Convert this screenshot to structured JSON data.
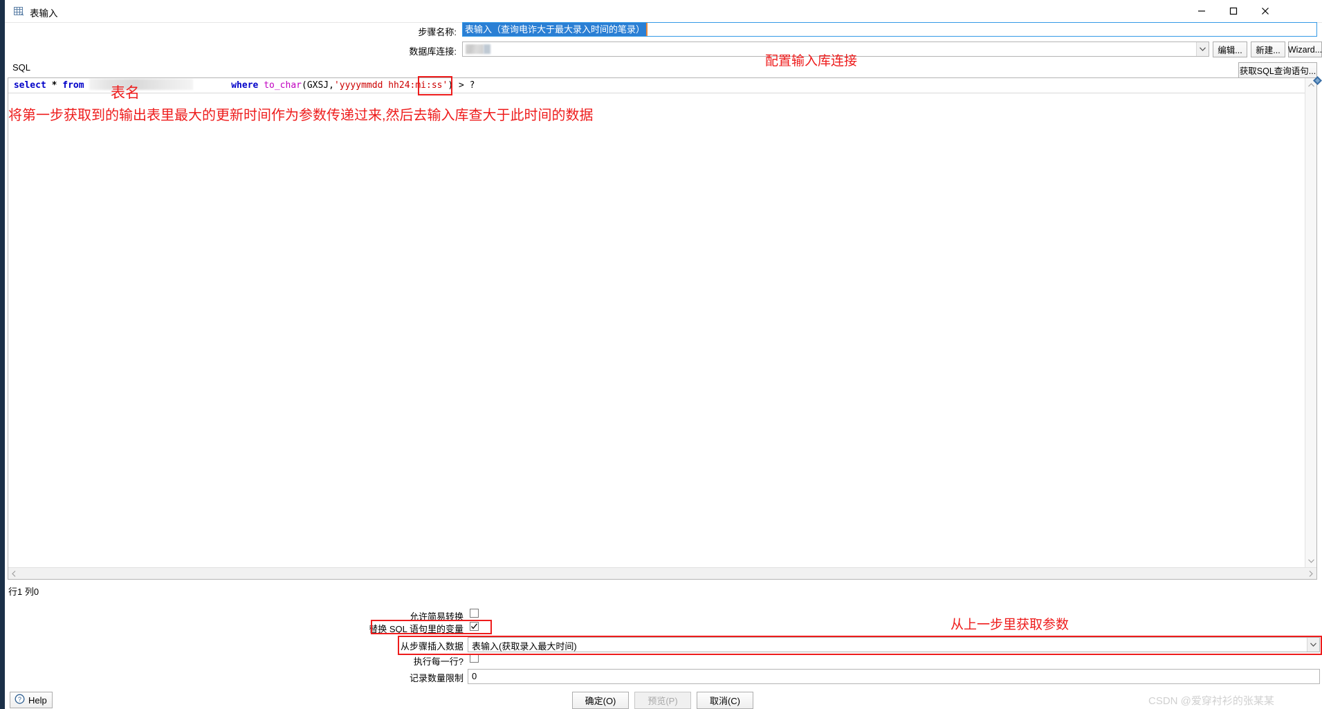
{
  "window": {
    "title": "表输入",
    "icon": "table-input-icon",
    "minimize": "minimize-icon",
    "maximize": "maximize-icon",
    "close": "close-icon"
  },
  "header": {
    "step_name_label": "步骤名称:",
    "step_name_value": "表输入（查询电诈大于最大录入时间的笔录）",
    "connection_label": "数据库连接:",
    "connection_value": "",
    "edit_button": "编辑...",
    "new_button": "新建...",
    "wizard_button": "Wizard...",
    "get_sql_button": "获取SQL查询语句..."
  },
  "sql": {
    "label": "SQL",
    "tokens": {
      "select": "select",
      "star": "*",
      "from": "from",
      "table": "",
      "where": "where",
      "to_char": "to_char",
      "paren_open": "(",
      "column": "GXSJ",
      "comma": ",",
      "format": "'yyyymmdd hh24:mi:ss'",
      "paren_close": ")",
      "gt": ">",
      "param": "?"
    },
    "status": "行1 列0"
  },
  "options": {
    "allow_lazy_label": "允许简易转换",
    "allow_lazy_checked": false,
    "replace_vars_label": "替换 SQL 语句里的变量",
    "replace_vars_checked": true,
    "insert_from_step_label": "从步骤插入数据",
    "insert_from_step_value": "表输入(获取录入最大时间)",
    "execute_each_row_label": "执行每一行?",
    "execute_each_row_checked": false,
    "limit_label": "记录数量限制",
    "limit_value": "0"
  },
  "buttons": {
    "ok": "确定(O)",
    "preview": "预览(P)",
    "preview_disabled": true,
    "cancel": "取消(C)",
    "help": "Help"
  },
  "annotations": {
    "connection": "配置输入库连接",
    "table_name": "表名",
    "sql_explain": "将第一步获取到的输出表里最大的更新时间作为参数传递过来,然后去输入库查大于此时间的数据",
    "param_from_prev_step": "从上一步里获取参数"
  },
  "watermark": "CSDN @爱穿衬衫的张某某",
  "colors": {
    "annotation_red": "#ee1c1c",
    "selection_blue": "#2a7fd4",
    "title_stripe": "#1b3048",
    "keyword_blue": "#0000c8",
    "string_red": "#cc0000",
    "function_magenta": "#c000c0"
  }
}
